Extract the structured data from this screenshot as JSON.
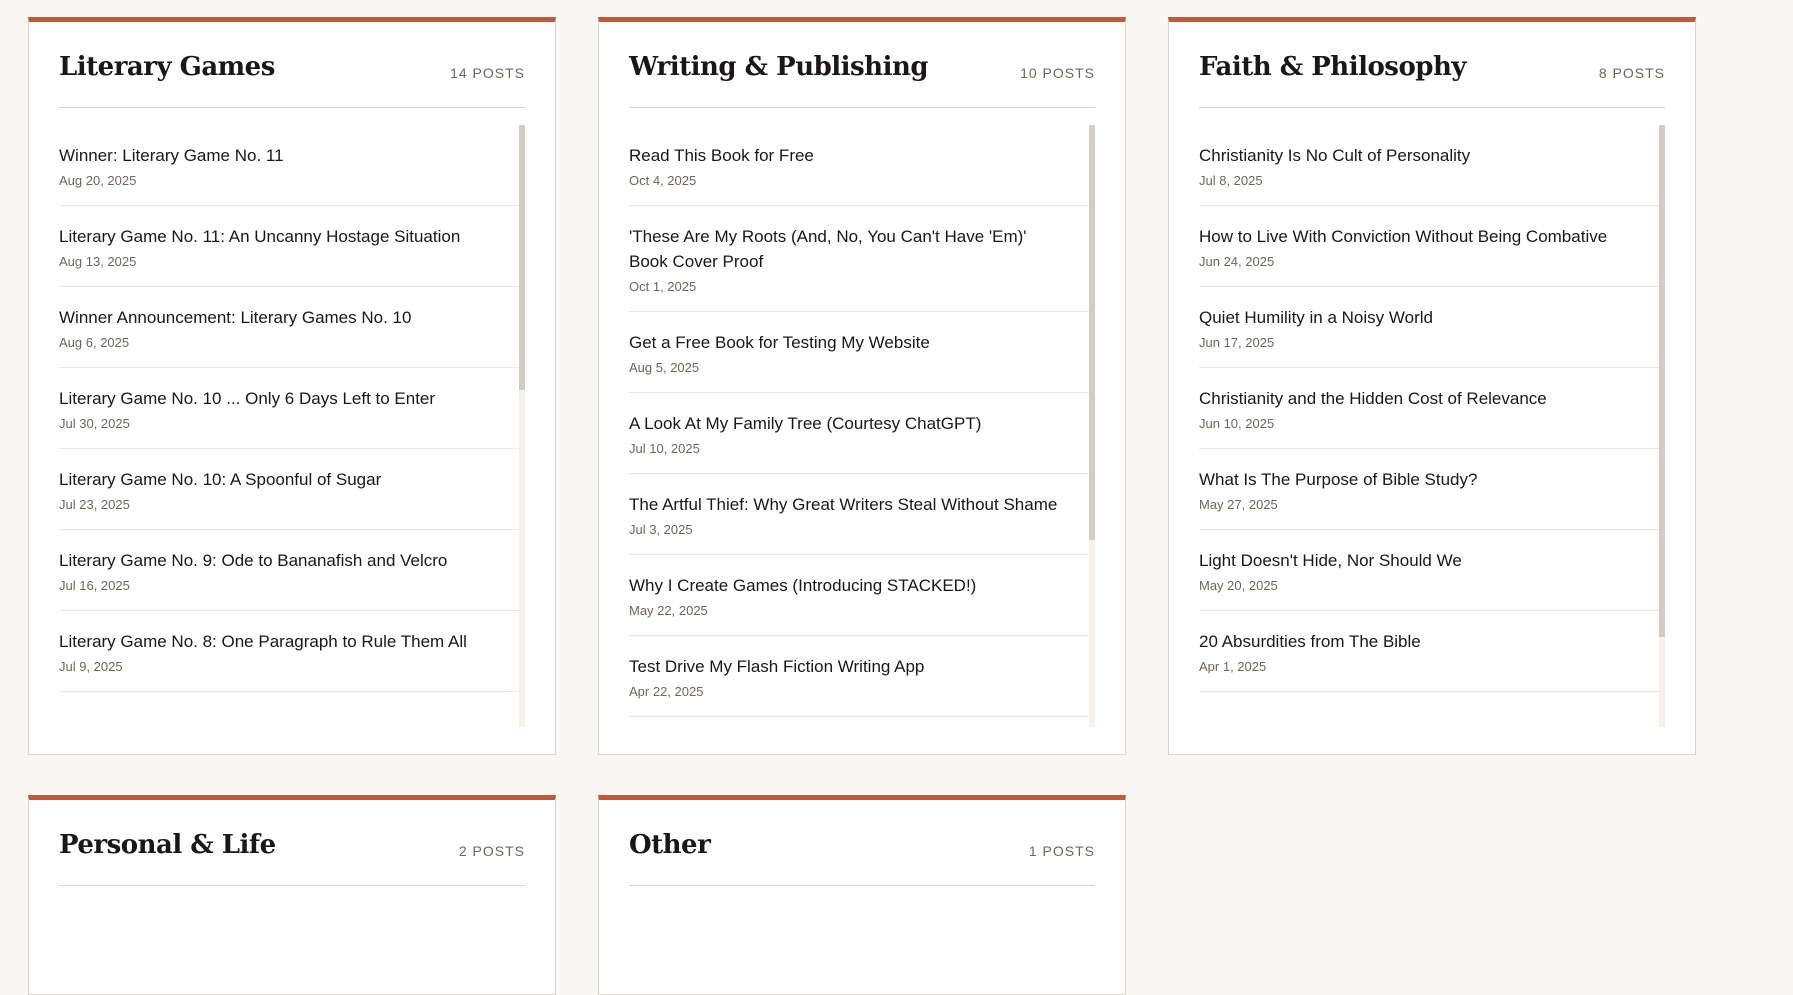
{
  "sections": [
    {
      "title": "Literary Games",
      "count": "14 POSTS",
      "scroll": 0.44,
      "posts": [
        {
          "title": "Winner: Literary Game No. 11",
          "date": "Aug 20, 2025"
        },
        {
          "title": "Literary Game No. 11: An Uncanny Hostage Situation",
          "date": "Aug 13, 2025"
        },
        {
          "title": "Winner Announcement: Literary Games No. 10",
          "date": "Aug 6, 2025"
        },
        {
          "title": "Literary Game No. 10 ... Only 6 Days Left to Enter",
          "date": "Jul 30, 2025"
        },
        {
          "title": "Literary Game No. 10: A Spoonful of Sugar",
          "date": "Jul 23, 2025"
        },
        {
          "title": "Literary Game No. 9: Ode to Bananafish and Velcro",
          "date": "Jul 16, 2025"
        },
        {
          "title": "Literary Game No. 8: One Paragraph to Rule Them All",
          "date": "Jul 9, 2025"
        }
      ]
    },
    {
      "title": "Writing & Publishing",
      "count": "10 POSTS",
      "scroll": 0.69,
      "posts": [
        {
          "title": "Read This Book for Free",
          "date": "Oct 4, 2025"
        },
        {
          "title": "'These Are My Roots (And, No, You Can't Have 'Em)' Book Cover Proof",
          "date": "Oct 1, 2025"
        },
        {
          "title": "Get a Free Book for Testing My Website",
          "date": "Aug 5, 2025"
        },
        {
          "title": "A Look At My Family Tree (Courtesy ChatGPT)",
          "date": "Jul 10, 2025"
        },
        {
          "title": "The Artful Thief: Why Great Writers Steal Without Shame",
          "date": "Jul 3, 2025"
        },
        {
          "title": "Why I Create Games (Introducing STACKED!)",
          "date": "May 22, 2025"
        },
        {
          "title": "Test Drive My Flash Fiction Writing App",
          "date": "Apr 22, 2025"
        }
      ]
    },
    {
      "title": "Faith & Philosophy",
      "count": "8 POSTS",
      "scroll": 0.85,
      "posts": [
        {
          "title": "Christianity Is No Cult of Personality",
          "date": "Jul 8, 2025"
        },
        {
          "title": "How to Live With Conviction Without Being Combative",
          "date": "Jun 24, 2025"
        },
        {
          "title": "Quiet Humility in a Noisy World",
          "date": "Jun 17, 2025"
        },
        {
          "title": "Christianity and the Hidden Cost of Relevance",
          "date": "Jun 10, 2025"
        },
        {
          "title": "What Is The Purpose of Bible Study?",
          "date": "May 27, 2025"
        },
        {
          "title": "Light Doesn't Hide, Nor Should We",
          "date": "May 20, 2025"
        },
        {
          "title": "20 Absurdities from The Bible",
          "date": "Apr 1, 2025"
        }
      ]
    },
    {
      "title": "Personal & Life",
      "count": "2 POSTS",
      "posts": []
    },
    {
      "title": "Other",
      "count": "1 POSTS",
      "posts": []
    }
  ],
  "colors": {
    "accent": "#c05a3c",
    "background": "#f9f7f4",
    "card": "#ffffff",
    "text": "#1a1716",
    "muted": "#6d665f"
  }
}
